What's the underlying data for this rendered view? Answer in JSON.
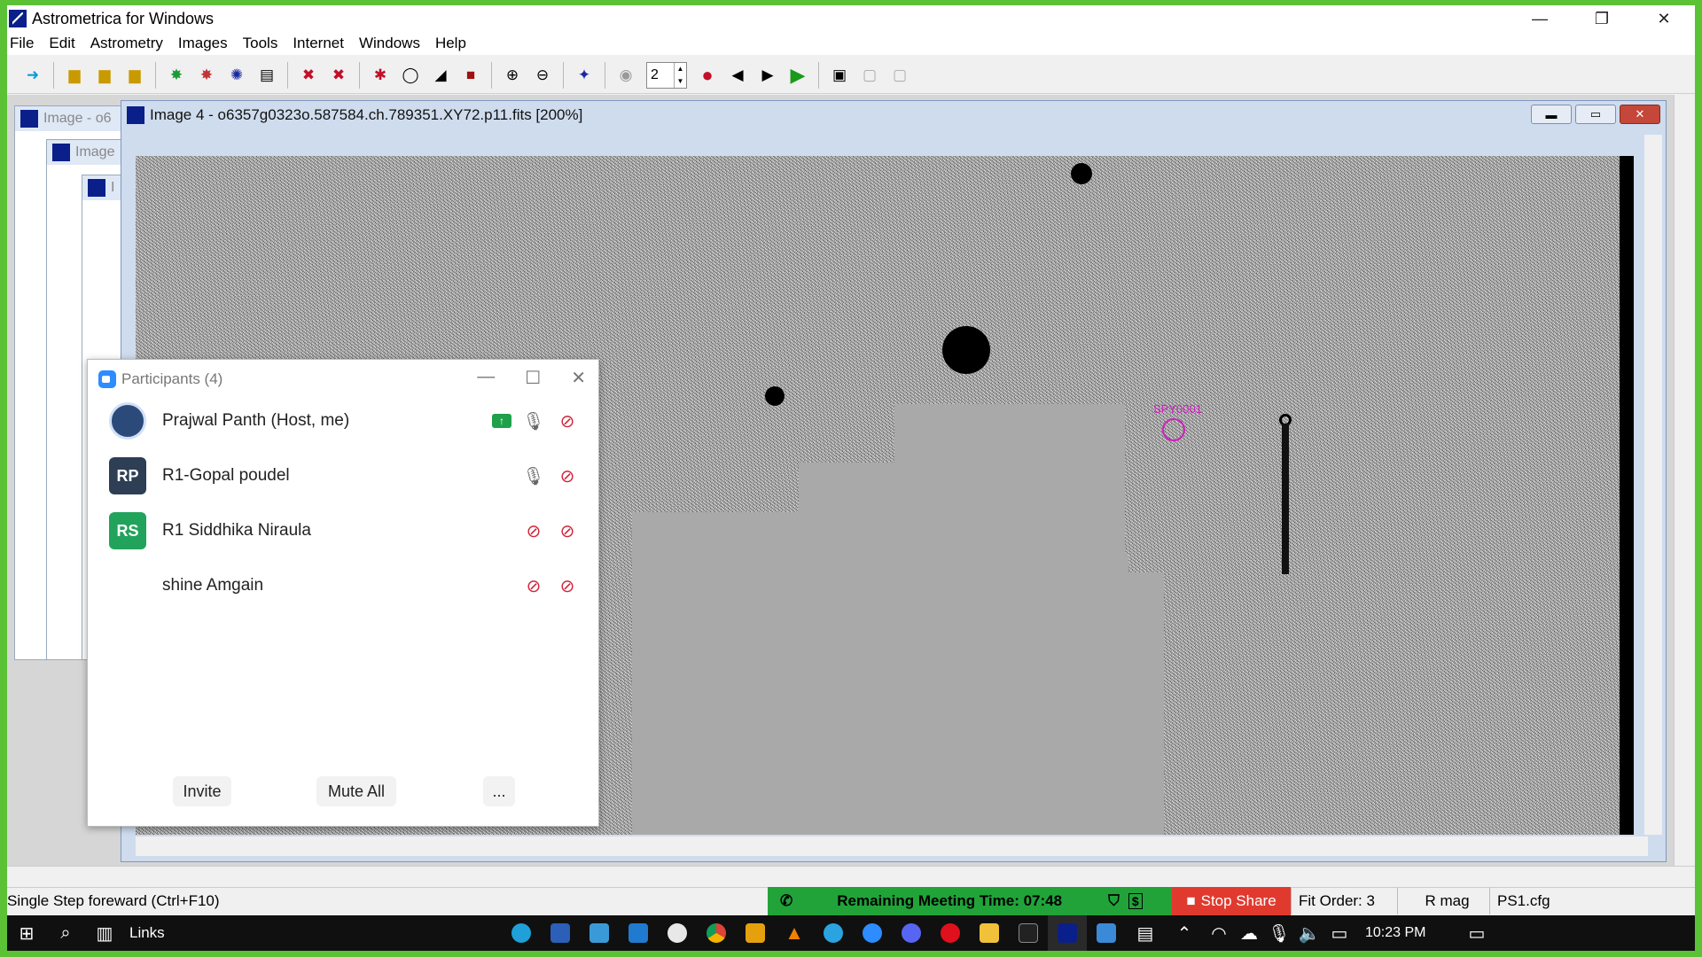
{
  "app": {
    "title": "Astrometrica for Windows",
    "minimize": "—",
    "restore": "❐",
    "close": "✕"
  },
  "menu": [
    "File",
    "Edit",
    "Astrometry",
    "Images",
    "Tools",
    "Internet",
    "Windows",
    "Help"
  ],
  "toolbar": {
    "spin_value": "2"
  },
  "background_windows": [
    {
      "title": "Image - o6"
    },
    {
      "title": "Image"
    },
    {
      "title": "I"
    }
  ],
  "image_window": {
    "title": "Image 4 - o6357g0323o.587584.ch.789351.XY72.p11.fits [200%]",
    "target_label": "SPY0001"
  },
  "participants": {
    "title": "Participants (4)",
    "people": [
      {
        "name": "Prajwal Panth (Host, me)",
        "initials": "",
        "color": "#2b4a7a",
        "sharing": true,
        "mic": "on",
        "video": "off"
      },
      {
        "name": "R1-Gopal poudel",
        "initials": "RP",
        "color": "#2d3e55",
        "sharing": false,
        "mic": "on",
        "video": "off"
      },
      {
        "name": "R1 Siddhika Niraula",
        "initials": "RS",
        "color": "#21a35b",
        "sharing": false,
        "mic": "muted",
        "video": "off"
      },
      {
        "name": "shine Amgain",
        "initials": "",
        "color": "#ffffff",
        "sharing": false,
        "mic": "muted",
        "video": "off"
      }
    ],
    "buttons": {
      "invite": "Invite",
      "mute_all": "Mute All",
      "more": "..."
    }
  },
  "status": {
    "hint": "Single Step foreward (Ctrl+F10)",
    "meeting": "Remaining Meeting Time: 07:48",
    "stop_share": "Stop Share",
    "fit_order": "Fit Order: 3",
    "mag": "R mag",
    "cfg": "PS1.cfg"
  },
  "taskbar": {
    "links": "Links",
    "time": "10:23 PM"
  }
}
